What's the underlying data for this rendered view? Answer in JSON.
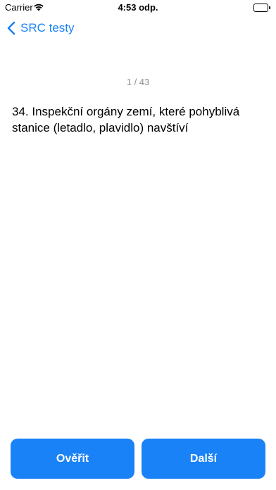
{
  "status_bar": {
    "carrier": "Carrier",
    "time": "4:53 odp.",
    "wifi_icon": "wifi-icon",
    "battery_icon": "battery-icon",
    "battery_level": 1.0
  },
  "nav": {
    "back_label": "SRC testy",
    "back_icon": "chevron-left-icon"
  },
  "counter": "1 / 43",
  "question": "34. Inspekční orgány zemí, které pohyblivá stanice (letadlo, plavidlo) navštíví",
  "buttons": {
    "check_label": "Ověřit",
    "next_label": "Další"
  },
  "colors": {
    "accent": "#1a82f7",
    "counter_text": "#8e8e93"
  }
}
